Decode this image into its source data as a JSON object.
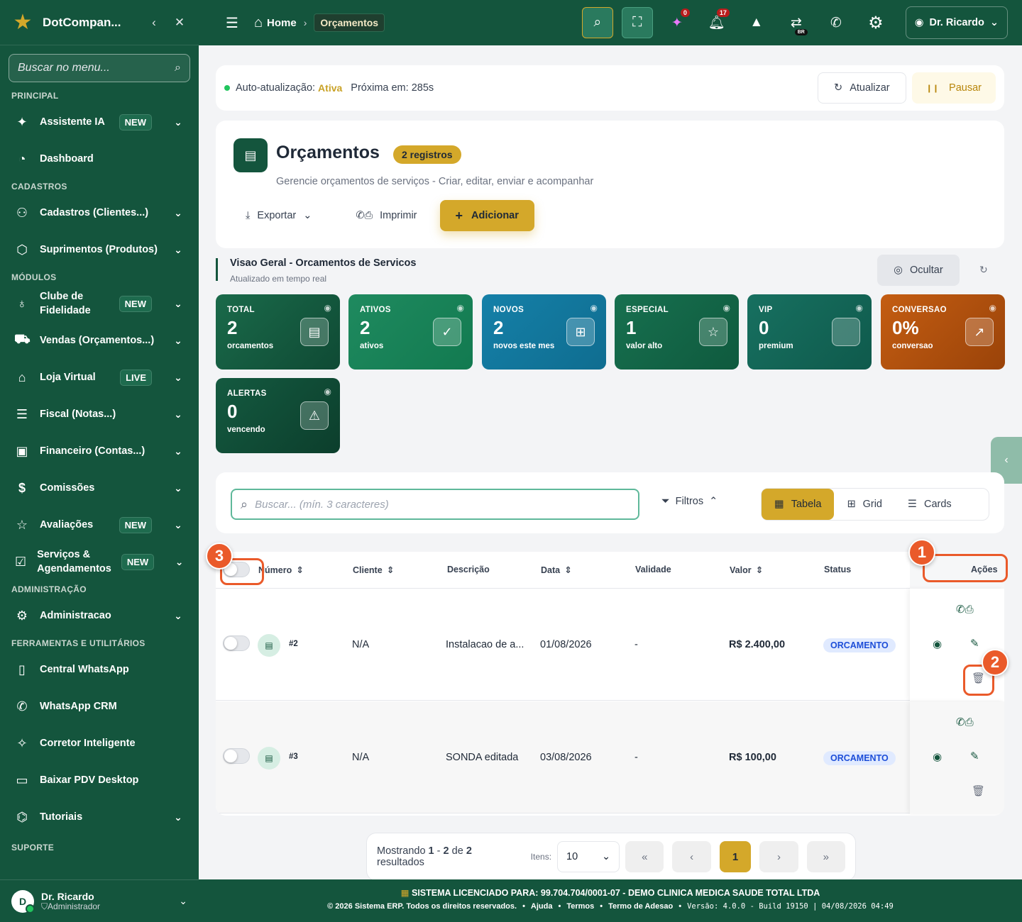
{
  "sidebar": {
    "brand": "DotCompan...",
    "search_placeholder": "Buscar no menu...",
    "sections": {
      "principal": "PRINCIPAL",
      "cadastros": "CADASTROS",
      "modulos": "MÓDULOS",
      "administracao": "ADMINISTRAÇÃO",
      "ferramentas": "FERRAMENTAS E UTILITÁRIOS",
      "suporte": "SUPORTE"
    },
    "items": [
      {
        "label": "Assistente IA",
        "badge": "NEW",
        "icon": "sparkles-icon"
      },
      {
        "label": "Dashboard",
        "badge": "",
        "icon": "gauge-icon"
      },
      {
        "label": "Cadastros (Clientes...)",
        "badge": "",
        "icon": "users-icon"
      },
      {
        "label": "Suprimentos (Produtos)",
        "badge": "",
        "icon": "box-icon"
      },
      {
        "label": "Clube de Fidelidade",
        "badge": "NEW",
        "icon": "medal-icon"
      },
      {
        "label": "Vendas (Orçamentos...)",
        "badge": "",
        "icon": "cart-icon"
      },
      {
        "label": "Loja Virtual",
        "badge": "LIVE",
        "icon": "store-icon"
      },
      {
        "label": "Fiscal (Notas...)",
        "badge": "",
        "icon": "receipt-icon"
      },
      {
        "label": "Financeiro (Contas...)",
        "badge": "",
        "icon": "money-icon"
      },
      {
        "label": "Comissões",
        "badge": "",
        "icon": "commission-icon"
      },
      {
        "label": "Avaliações",
        "badge": "NEW",
        "icon": "star-icon"
      },
      {
        "label": "Serviços & Agendamentos",
        "badge": "NEW",
        "icon": "calendar-check-icon"
      },
      {
        "label": "Administracao",
        "badge": "",
        "icon": "gear-icon"
      },
      {
        "label": "Central WhatsApp",
        "badge": "",
        "icon": "phone-vibrate-icon"
      },
      {
        "label": "WhatsApp CRM",
        "badge": "",
        "icon": "whatsapp-icon"
      },
      {
        "label": "Corretor Inteligente",
        "badge": "",
        "icon": "magic-wand-icon"
      },
      {
        "label": "Baixar PDV Desktop",
        "badge": "",
        "icon": "desktop-icon"
      },
      {
        "label": "Tutoriais",
        "badge": "",
        "icon": "graduation-icon"
      }
    ],
    "user": {
      "initial": "D",
      "name": "Dr. Ricardo",
      "role": "Administrador"
    }
  },
  "topbar": {
    "home": "Home",
    "crumb": "Orçamentos",
    "badge_ai": "0",
    "badge_notifications": "17",
    "lang": "BR",
    "user": "Dr. Ricardo"
  },
  "autorefresh": {
    "label": "Auto-atualização:",
    "state": "Ativa",
    "next_label": "Próxima em:",
    "next_value": "285s",
    "refresh_btn": "Atualizar",
    "pause_btn": "Pausar"
  },
  "header": {
    "title": "Orçamentos",
    "count": "2 registros",
    "subtitle": "Gerencie orçamentos de serviços - Criar, editar, enviar e acompanhar",
    "export": "Exportar",
    "print": "Imprimir",
    "add": "Adicionar"
  },
  "overview": {
    "title": "Visao Geral - Orcamentos de Servicos",
    "subtitle": "Atualizado em tempo real",
    "hide": "Ocultar",
    "stats": [
      {
        "label": "TOTAL",
        "value": "2",
        "sub": "orcamentos",
        "color": "#14553d",
        "icon": "document-icon"
      },
      {
        "label": "ATIVOS",
        "value": "2",
        "sub": "ativos",
        "color": "#1e8a60",
        "icon": "check-circle-icon"
      },
      {
        "label": "NOVOS",
        "value": "2",
        "sub": "novos este mes",
        "color": "#1478a0",
        "icon": "calendar-plus-icon"
      },
      {
        "label": "ESPECIAL",
        "value": "1",
        "sub": "valor alto",
        "color": "#136b4c",
        "icon": "star-icon"
      },
      {
        "label": "VIP",
        "value": "0",
        "sub": "premium",
        "color": "#136a5c",
        "icon": "crown-icon"
      },
      {
        "label": "CONVERSAO",
        "value": "0%",
        "sub": "conversao",
        "color": "#b4510f",
        "icon": "trend-up-icon"
      },
      {
        "label": "ALERTAS",
        "value": "0",
        "sub": "vencendo",
        "color": "#0f4a34",
        "icon": "warning-icon"
      }
    ]
  },
  "toolbar": {
    "search_placeholder": "Buscar... (mín. 3 caracteres)",
    "filters": "Filtros",
    "views": [
      "Tabela",
      "Grid",
      "Cards"
    ]
  },
  "table": {
    "columns": [
      "Número",
      "Cliente",
      "Descrição",
      "Data",
      "Validade",
      "Valor",
      "Status",
      "Ações"
    ],
    "rows": [
      {
        "numero": "#2",
        "cliente": "N/A",
        "descricao": "Instalacao de a...",
        "data": "01/08/2026",
        "validade": "-",
        "valor": "R$ 2.400,00",
        "status": "ORCAMENTO"
      },
      {
        "numero": "#3",
        "cliente": "N/A",
        "descricao": "SONDA editada",
        "data": "03/08/2026",
        "validade": "-",
        "valor": "R$ 100,00",
        "status": "ORCAMENTO"
      }
    ]
  },
  "pagination": {
    "showing": "Mostrando",
    "from": "1",
    "dash": "-",
    "to": "2",
    "of": "de",
    "total": "2",
    "results": "resultados",
    "items_label": "Itens:",
    "items_value": "10",
    "current_page": "1"
  },
  "footer": {
    "license": "SISTEMA LICENCIADO PARA: 99.704.704/0001-07 - DEMO CLINICA MEDICA SAUDE TOTAL LTDA",
    "copyright": "© 2026 Sistema ERP. Todos os direitos reservados.",
    "links": [
      "Ajuda",
      "Termos",
      "Termo de Adesao"
    ],
    "version": "Versão: 4.0.0 - Build 19150 | 04/08/2026 04:49"
  },
  "markers": [
    "1",
    "2",
    "3"
  ]
}
